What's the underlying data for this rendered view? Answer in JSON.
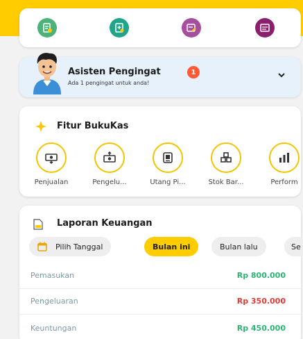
{
  "quick_actions": [
    {
      "icon": "receipt-add-icon",
      "color": "#4cb17a"
    },
    {
      "icon": "document-add-icon",
      "color": "#20a58a"
    },
    {
      "icon": "note-edit-icon",
      "color": "#a64f9e"
    },
    {
      "icon": "report-icon",
      "color": "#8a1f6d"
    }
  ],
  "reminder": {
    "title": "Asisten Pengingat",
    "badge": "1",
    "subtitle": "Ada 1 pengingat untuk anda!"
  },
  "features": {
    "title": "Fitur BukuKas",
    "items": [
      {
        "label": "Penjualan",
        "icon": "money-in-icon"
      },
      {
        "label": "Pengelu...",
        "icon": "money-out-icon"
      },
      {
        "label": "Utang Pi...",
        "icon": "debt-icon"
      },
      {
        "label": "Stok Bar...",
        "icon": "stock-icon"
      },
      {
        "label": "Perform",
        "icon": "bar-chart-icon"
      }
    ]
  },
  "report": {
    "title": "Laporan Keuangan",
    "chips": {
      "pick_date": "Pilih Tanggal",
      "this_month": "Bulan ini",
      "last_month": "Bulan lalu",
      "more": "Se"
    },
    "rows": [
      {
        "label": "Pemasukan",
        "value": "Rp 800.000",
        "color": "#2bb673"
      },
      {
        "label": "Pengeluaran",
        "value": "Rp 350.000",
        "color": "#e53935"
      },
      {
        "label": "Keuntungan",
        "value": "Rp 450.000",
        "color": "#2bb673"
      }
    ]
  },
  "colors": {
    "brand": "#ffcc00",
    "feature_ring": "#f5c400"
  }
}
